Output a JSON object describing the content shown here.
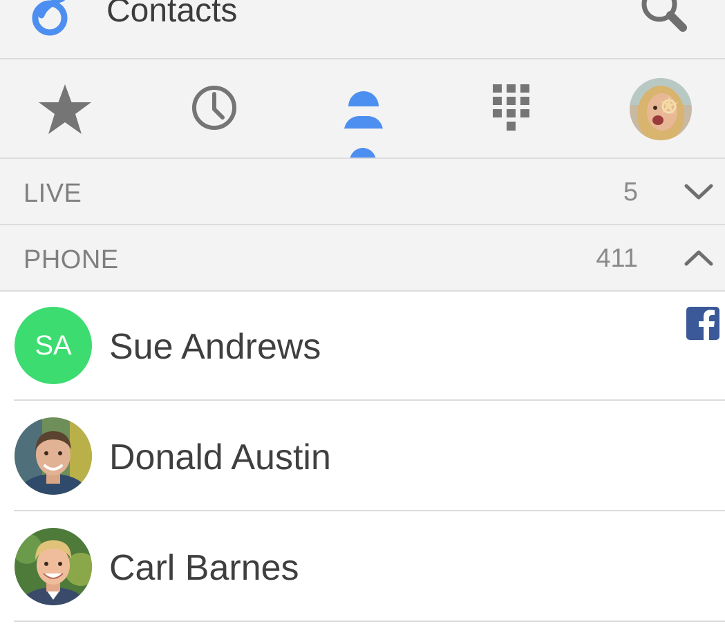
{
  "app": {
    "title": "Contacts",
    "logo_icon": "app-logo-6-icon",
    "accent_color": "#4d8ff0"
  },
  "toolbar": {
    "search_icon": "search-icon"
  },
  "tabs": [
    {
      "name": "favorites",
      "icon": "star-icon",
      "active": false
    },
    {
      "name": "recents",
      "icon": "clock-icon",
      "active": false
    },
    {
      "name": "contacts",
      "icon": "person-icon",
      "active": true
    },
    {
      "name": "dialpad",
      "icon": "dialpad-icon",
      "active": false
    },
    {
      "name": "profile",
      "icon": "profile-avatar",
      "active": false
    }
  ],
  "sections": [
    {
      "label": "LIVE",
      "count": "5",
      "expanded": false,
      "chevron_icon": "chevron-down-icon"
    },
    {
      "label": "PHONE",
      "count": "411",
      "expanded": true,
      "chevron_icon": "chevron-up-icon"
    }
  ],
  "contacts": [
    {
      "name": "Sue Andrews",
      "initials": "SA",
      "avatar_color": "#3ddc70",
      "badge_icon": "facebook-icon"
    },
    {
      "name": "Donald Austin",
      "initials": "",
      "avatar_icon": "photo-avatar"
    },
    {
      "name": "Carl Barnes",
      "initials": "",
      "avatar_icon": "photo-avatar"
    }
  ]
}
